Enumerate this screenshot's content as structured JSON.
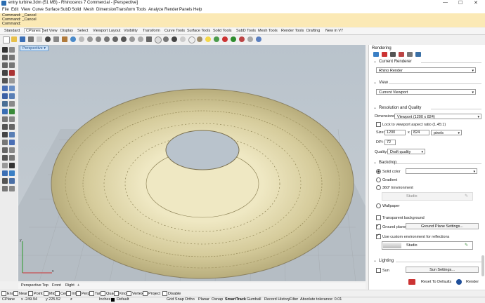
{
  "window": {
    "title": "entry turbine.3dm (51 MB) - Rhinoceros 7 Commercial - [Perspective]",
    "min": "—",
    "max": "☐",
    "close": "✕"
  },
  "menu": [
    "File",
    "Edit",
    "View",
    "Curve",
    "Surface",
    "SubD",
    "Solid",
    "Mesh",
    "Dimension",
    "Transform",
    "Tools",
    "Analyze",
    "Render",
    "Panels",
    "Help"
  ],
  "command": {
    "line1": "Command: _Cancel",
    "line2": "Command: _Cancel",
    "prompt": "Command:"
  },
  "toolbar_tabs": [
    "Standard",
    "CPlanes",
    "Set View",
    "Display",
    "Select",
    "Viewport Layout",
    "Visibility",
    "Transform",
    "Curve Tools",
    "Surface Tools",
    "Solid Tools",
    "SubD Tools",
    "Mesh Tools",
    "Render Tools",
    "Drafting",
    "New in V7"
  ],
  "viewport": {
    "label": "Perspective",
    "arrow": "▾",
    "axis_y": "y",
    "axis_x": "x"
  },
  "viewport_tabs": [
    "Perspective",
    "Top",
    "Front",
    "Right",
    "+"
  ],
  "osnaps": [
    "End",
    "Near",
    "Point",
    "Mid",
    "Cen",
    "Int",
    "Perp",
    "Tan",
    "Quad",
    "Knot",
    "Vertex",
    "Project",
    "Disable"
  ],
  "status": {
    "cplane": "CPlane",
    "x": "x -249.94",
    "y": "y 225.52",
    "z": "z",
    "units": "Inches",
    "layer": "Default",
    "grid_snap": "Grid Snap",
    "ortho": "Ortho",
    "planar": "Planar",
    "osnap": "Osnap",
    "smarttrack": "SmartTrack",
    "gumball": "Gumball",
    "record_history": "Record History",
    "filter": "Filter",
    "tolerance": "Absolute tolerance: 0.01"
  },
  "panel": {
    "title": "Rendering",
    "current_renderer": {
      "heading": "Current Renderer",
      "value": "Rhino Render"
    },
    "view": {
      "heading": "View",
      "value": "Current Viewport"
    },
    "resolution": {
      "heading": "Resolution and Quality",
      "dimensions_label": "Dimensions:",
      "dimensions_value": "Viewport (1200 x 824)",
      "lock_label": "Lock to viewport aspect ratio (1.45:1)",
      "size_label": "Size:",
      "width": "1200",
      "x": "x",
      "height": "824",
      "units": "pixels",
      "dpi_label": "DPI:",
      "dpi": "72",
      "quality_label": "Quality:",
      "quality": "Draft quality"
    },
    "backdrop": {
      "heading": "Backdrop",
      "solid": "Solid color",
      "gradient": "Gradient",
      "env360": "360° Environment",
      "env_name": "Studio",
      "wallpaper": "Wallpaper",
      "transparent": "Transparent background",
      "ground_plane": "Ground plane",
      "ground_plane_btn": "Ground Plane Settings...",
      "custom_env": "Use custom environment for reflections",
      "custom_env_name": "Studio"
    },
    "lighting": {
      "heading": "Lighting",
      "sun": "Sun",
      "sun_btn": "Sun Settings..."
    },
    "reset": "Reset To Defaults",
    "render": "Render"
  }
}
